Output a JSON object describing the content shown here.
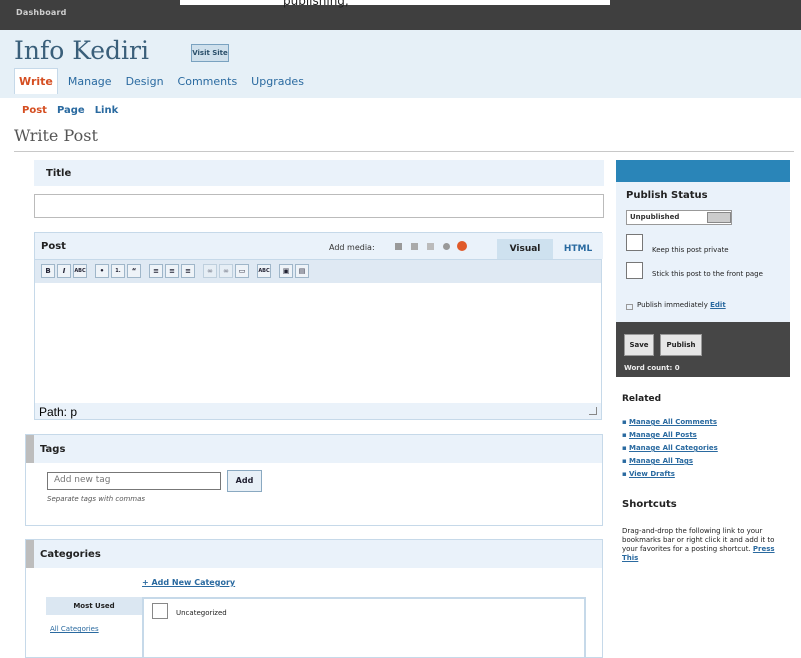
{
  "topbar": {
    "dashboard_label": "Dashboard",
    "obscured_text": "publishing,"
  },
  "header": {
    "blog_name": "Info Kediri",
    "visit_site": "Visit Site"
  },
  "menu": [
    "Write",
    "Manage",
    "Design",
    "Comments",
    "Upgrades"
  ],
  "submenu": [
    "Post",
    "Page",
    "Link"
  ],
  "page_title": "Write Post",
  "title_box": {
    "label": "Title",
    "value": ""
  },
  "post_box": {
    "label": "Post",
    "add_media": "Add media:",
    "tab_visual": "Visual",
    "tab_html": "HTML",
    "path": "Path: p"
  },
  "toolbar_buttons": [
    "B",
    "I",
    "ABC",
    "•",
    "1.",
    "“",
    "≡",
    "≡",
    "≡",
    "∞",
    "∞",
    "▭",
    "ABC",
    "▣",
    "▤"
  ],
  "tags": {
    "label": "Tags",
    "placeholder": "Add new tag",
    "add_button": "Add",
    "hint": "Separate tags with commas"
  },
  "categories": {
    "label": "Categories",
    "add_new": "+ Add New Category",
    "tab_most_used": "Most Used",
    "tab_all": "All Categories",
    "item": "Uncategorized"
  },
  "sidebar": {
    "publish_status": "Publish Status",
    "status_value": "Unpublished",
    "keep_private": "Keep this post private",
    "stick_front": "Stick this post to the front page",
    "publish_immediately": "Publish immediately",
    "edit_link": "Edit",
    "save": "Save",
    "publish": "Publish",
    "word_count": "Word count: 0",
    "related_title": "Related",
    "related_links": [
      "Manage All Comments",
      "Manage All Posts",
      "Manage All Categories",
      "Manage All Tags",
      "View Drafts"
    ],
    "shortcuts_title": "Shortcuts",
    "shortcuts_text": "Drag-and-drop the following link to your bookmarks bar or right click it and add it to your favorites for a posting shortcut.",
    "press_this": "Press This"
  },
  "colors": {
    "topbar": "#3f3f3f",
    "header_bg": "#e6f0f7",
    "accent_orange": "#d54e21",
    "link_blue": "#2a6aa0",
    "sidebar_top": "#2a85b8",
    "actions_bg": "#464646"
  }
}
